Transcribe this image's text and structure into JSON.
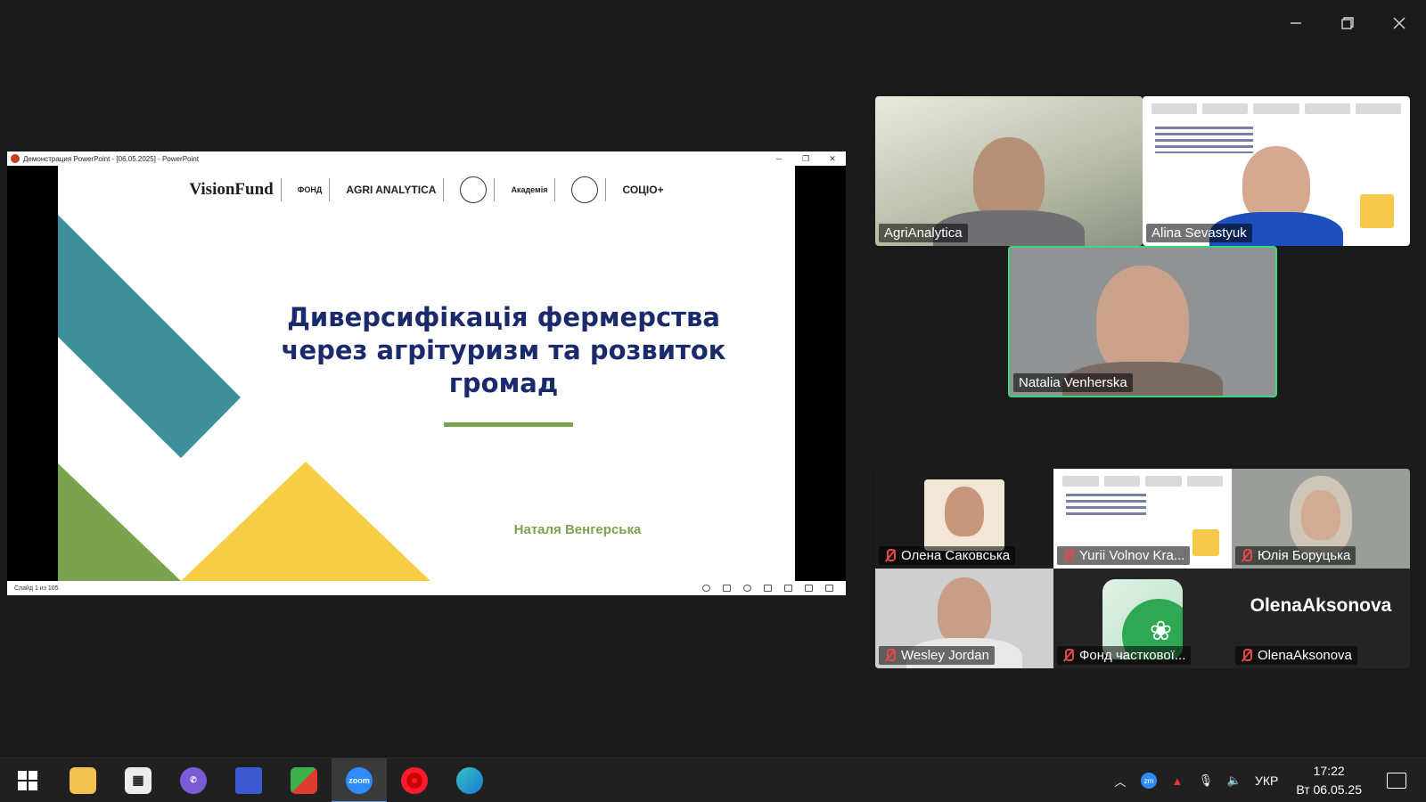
{
  "window": {
    "controls": [
      "minimize",
      "restore",
      "close"
    ]
  },
  "shared_screen": {
    "ppt_titlebar": "Демонстрация PowerPoint - [06.05.2025] - PowerPoint",
    "slide": {
      "logos": [
        "VisionFund",
        "ФОНД",
        "AGRI ANALYTICA",
        "Академія",
        "СОЦІО+"
      ],
      "title": "Диверсифікація фермерства через агрітуризм та розвиток громад",
      "author": "Наталя Венгерська",
      "accent_colors": {
        "teal": "#3d8f9a",
        "green": "#7aa34f",
        "yellow": "#f6cd45",
        "navy": "#1a2a6c"
      }
    },
    "status": {
      "slide_number": "Слайд 1 из 105"
    }
  },
  "participants": {
    "top": [
      {
        "name": "AgriAnalytica"
      },
      {
        "name": "Alina Sevastyuk"
      },
      {
        "name": "Natalia Venherska",
        "speaking": true
      }
    ],
    "gallery": [
      {
        "name": "Олена Саковська",
        "muted": true
      },
      {
        "name": "Yurii Volnov Kra...",
        "muted": true
      },
      {
        "name": "Юлія Боруцька",
        "muted": true
      },
      {
        "name": "Wesley Jordan",
        "muted": true
      },
      {
        "name": "Фонд часткової...",
        "muted": true
      },
      {
        "name": "OlenaAksonova",
        "muted": true,
        "display_text": "OlenaAksonova"
      }
    ]
  },
  "taskbar": {
    "apps": [
      "start",
      "file-explorer",
      "calculator",
      "viber",
      "save",
      "app-red-green",
      "zoom",
      "opera",
      "edge"
    ],
    "zoom_label": "zoom",
    "tray": {
      "language": "УКР",
      "time": "17:22",
      "date": "Вт 06.05.25"
    }
  }
}
